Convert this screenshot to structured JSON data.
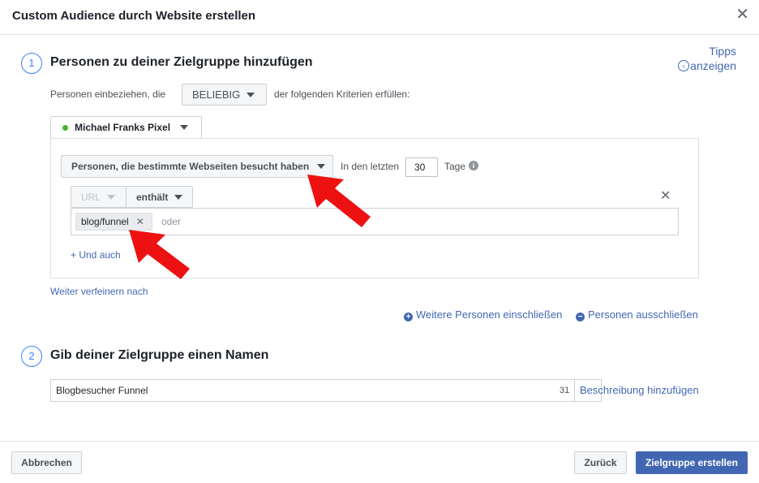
{
  "dialog": {
    "title": "Custom Audience durch Website erstellen",
    "tips_line1": "Tipps",
    "tips_line2": "anzeigen"
  },
  "step1": {
    "number": "1",
    "title": "Personen zu deiner Zielgruppe hinzufügen",
    "include_prefix": "Personen einbeziehen, die",
    "include_select": "BELIEBIG",
    "include_suffix": "der folgenden Kriterien erfüllen:",
    "pixel_name": "Michael Franks Pixel",
    "pixel_status_color": "#42b72a",
    "rule_select": "Personen, die bestimmte Webseiten besucht haben",
    "in_last_label": "In den letzten",
    "days_value": "30",
    "days_label": "Tage",
    "url_select": "URL",
    "operator_select": "enthält",
    "tag_value": "blog/funnel",
    "or_placeholder": "oder",
    "and_link": "+ Und auch",
    "refine_link": "Weiter verfeinern nach",
    "include_more": "Weitere Personen einschließen",
    "exclude_people": "Personen ausschließen"
  },
  "step2": {
    "number": "2",
    "title": "Gib deiner Zielgruppe einen Namen",
    "name_value": "Blogbesucher Funnel",
    "char_count": "31",
    "add_description": "Beschreibung hinzufügen"
  },
  "footer": {
    "cancel": "Abbrechen",
    "back": "Zurück",
    "create": "Zielgruppe erstellen"
  },
  "colors": {
    "accent": "#4267b2",
    "step_circle": "#4080ff",
    "annotation_arrow": "#ee1111"
  }
}
